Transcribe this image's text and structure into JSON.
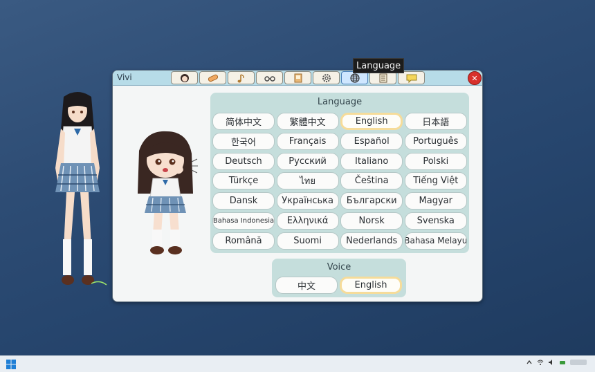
{
  "window": {
    "title": "Vivi",
    "tabs": [
      {
        "icon": "character-icon",
        "active": false
      },
      {
        "icon": "bandage-icon",
        "active": false
      },
      {
        "icon": "music-note-icon",
        "active": false
      },
      {
        "icon": "glasses-icon",
        "active": false
      },
      {
        "icon": "book-icon",
        "active": false
      },
      {
        "icon": "gear-icon",
        "active": false
      },
      {
        "icon": "globe-icon",
        "active": true
      },
      {
        "icon": "notebook-icon",
        "active": false
      },
      {
        "icon": "speech-bubble-icon",
        "active": false
      }
    ],
    "close_label": "✕",
    "tooltip": "Language"
  },
  "language": {
    "title": "Language",
    "selected": "English",
    "options": [
      "简体中文",
      "繁體中文",
      "English",
      "日本語",
      "한국어",
      "Français",
      "Español",
      "Português",
      "Deutsch",
      "Русский",
      "Italiano",
      "Polski",
      "Türkçe",
      "ไทย",
      "Čeština",
      "Tiếng Việt",
      "Dansk",
      "Українська",
      "Български",
      "Magyar",
      "Bahasa Indonesia",
      "Ελληνικά",
      "Norsk",
      "Svenska",
      "Română",
      "Suomi",
      "Nederlands",
      "Bahasa Melayu"
    ]
  },
  "voice": {
    "title": "Voice",
    "selected": "English",
    "options": [
      "中文",
      "English"
    ]
  },
  "colors": {
    "titlebar": "#b7dce8",
    "panel": "#c5dedc",
    "selected_border": "#f6dc9a",
    "close": "#d8302c"
  }
}
